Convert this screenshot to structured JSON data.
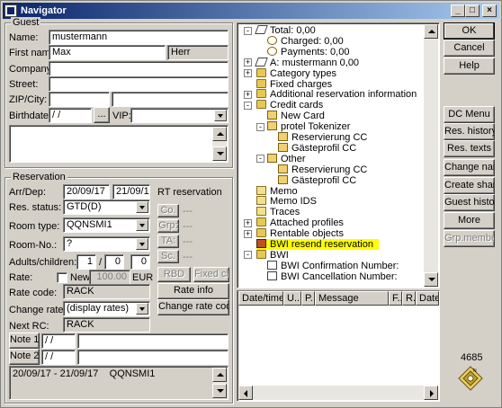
{
  "window": {
    "title": "Navigator",
    "minimize": "_",
    "maximize": "□",
    "close": "×"
  },
  "guest": {
    "group_label": "Guest",
    "name_label": "Name:",
    "name_value": "mustermann",
    "firstname_label": "First name:",
    "firstname_value": "Max",
    "salutation_value": "Herr",
    "company_label": "Company:",
    "company_value": "",
    "street_label": "Street:",
    "street_value": "",
    "zipcity_label": "ZIP/City:",
    "zip_value": "",
    "city_value": "",
    "birthdate_label": "Birthdate:",
    "birthdate_value": " / /",
    "dots_label": "...",
    "vip_label": "VIP:",
    "vip_value": "",
    "notes_value": ""
  },
  "reservation": {
    "group_label": "Reservation",
    "arrdep_label": "Arr/Dep:",
    "arr_value": "20/09/17",
    "dep_value": "21/09/17",
    "rt_reservation_label": "RT reservation",
    "status_label": "Res. status:",
    "status_value": "GTD(D)",
    "roomtype_label": "Room type:",
    "roomtype_value": "QQNSMI1",
    "roomno_label": "Room-No.:",
    "roomno_value": "?",
    "adults_label": "Adults/children:",
    "adults_value": "1",
    "slash": "/",
    "children_value": "0",
    "children2_value": "0",
    "rate_label": "Rate:",
    "new_label": "New",
    "rate_value": "100.00",
    "currency": "EUR",
    "ratecode_label": "Rate code:",
    "ratecode_value": "RACK",
    "changerate_label": "Change rate to:",
    "changerate_value": "(display rates)",
    "nextrc_label": "Next RC:",
    "nextrc_value": "RACK",
    "co_label": "Co.",
    "grp_label": "Grp:",
    "ta_label": "TA:",
    "sc_label": "Sc.",
    "co_dash": "---",
    "grp_dash": "---",
    "ta_dash": "---",
    "sc_dash": "---",
    "rbd_label": "RBD",
    "fixedch_label": "Fixed ch",
    "rateinfo_label": "Rate info",
    "changeratecode_label": "Change rate code",
    "note1_label": "Note 1:",
    "note1_date": " / /",
    "note1_value": "",
    "note2_label": "Note 2:",
    "note2_date": " / /",
    "note2_value": "",
    "summary_value": "20/09/17 - 21/09/17    QQNSMI1"
  },
  "tree": {
    "items": [
      {
        "label": "Total: 0,00",
        "icon": "pen-icon"
      },
      {
        "label": "Charged: 0,00",
        "icon": "coin-icon"
      },
      {
        "label": "Payments: 0,00",
        "icon": "coin-icon"
      },
      {
        "label": "A: mustermann 0,00",
        "icon": "pen-icon"
      },
      {
        "label": "Category types",
        "icon": "folder-icon"
      },
      {
        "label": "Fixed charges",
        "icon": "folder-icon"
      },
      {
        "label": "Additional reservation information",
        "icon": "folder-icon"
      },
      {
        "label": "Credit cards",
        "icon": "folder-icon"
      },
      {
        "label": "New Card",
        "icon": "card-icon"
      },
      {
        "label": "protel Tokenizer",
        "icon": "card-icon"
      },
      {
        "label": "Reservierung CC",
        "icon": "card-icon"
      },
      {
        "label": "Gästeprofil CC",
        "icon": "card-icon"
      },
      {
        "label": "Other",
        "icon": "card-icon"
      },
      {
        "label": "Reservierung CC",
        "icon": "card-icon"
      },
      {
        "label": "Gästeprofil CC",
        "icon": "card-icon"
      },
      {
        "label": "Memo",
        "icon": "memo-icon"
      },
      {
        "label": "Memo IDS",
        "icon": "memo-icon"
      },
      {
        "label": "Traces",
        "icon": "memo-icon"
      },
      {
        "label": "Attached profiles",
        "icon": "folder-icon"
      },
      {
        "label": "Rentable objects",
        "icon": "folder-icon"
      },
      {
        "label": "BWI resend reservation",
        "icon": "arrows-icon"
      },
      {
        "label": "BWI",
        "icon": "folder-icon"
      },
      {
        "label": "BWI Confirmation Number:",
        "icon": "doc-icon"
      },
      {
        "label": "BWI Cancellation Number:",
        "icon": "doc-icon"
      }
    ]
  },
  "grid": {
    "columns": [
      "Date/time",
      "U..",
      "P..",
      "Message",
      "F..",
      "R..",
      "Date"
    ]
  },
  "buttons": {
    "ok": "OK",
    "cancel": "Cancel",
    "help": "Help",
    "dcmenu": "DC Menu",
    "reshistory": "Res. history",
    "restexts": "Res. texts",
    "changename": "Change name",
    "createsharer": "Create sharer",
    "guesthistory": "Guest history",
    "more": "More",
    "grpmembers": "Grp.members"
  },
  "footer": {
    "number": "4685"
  }
}
